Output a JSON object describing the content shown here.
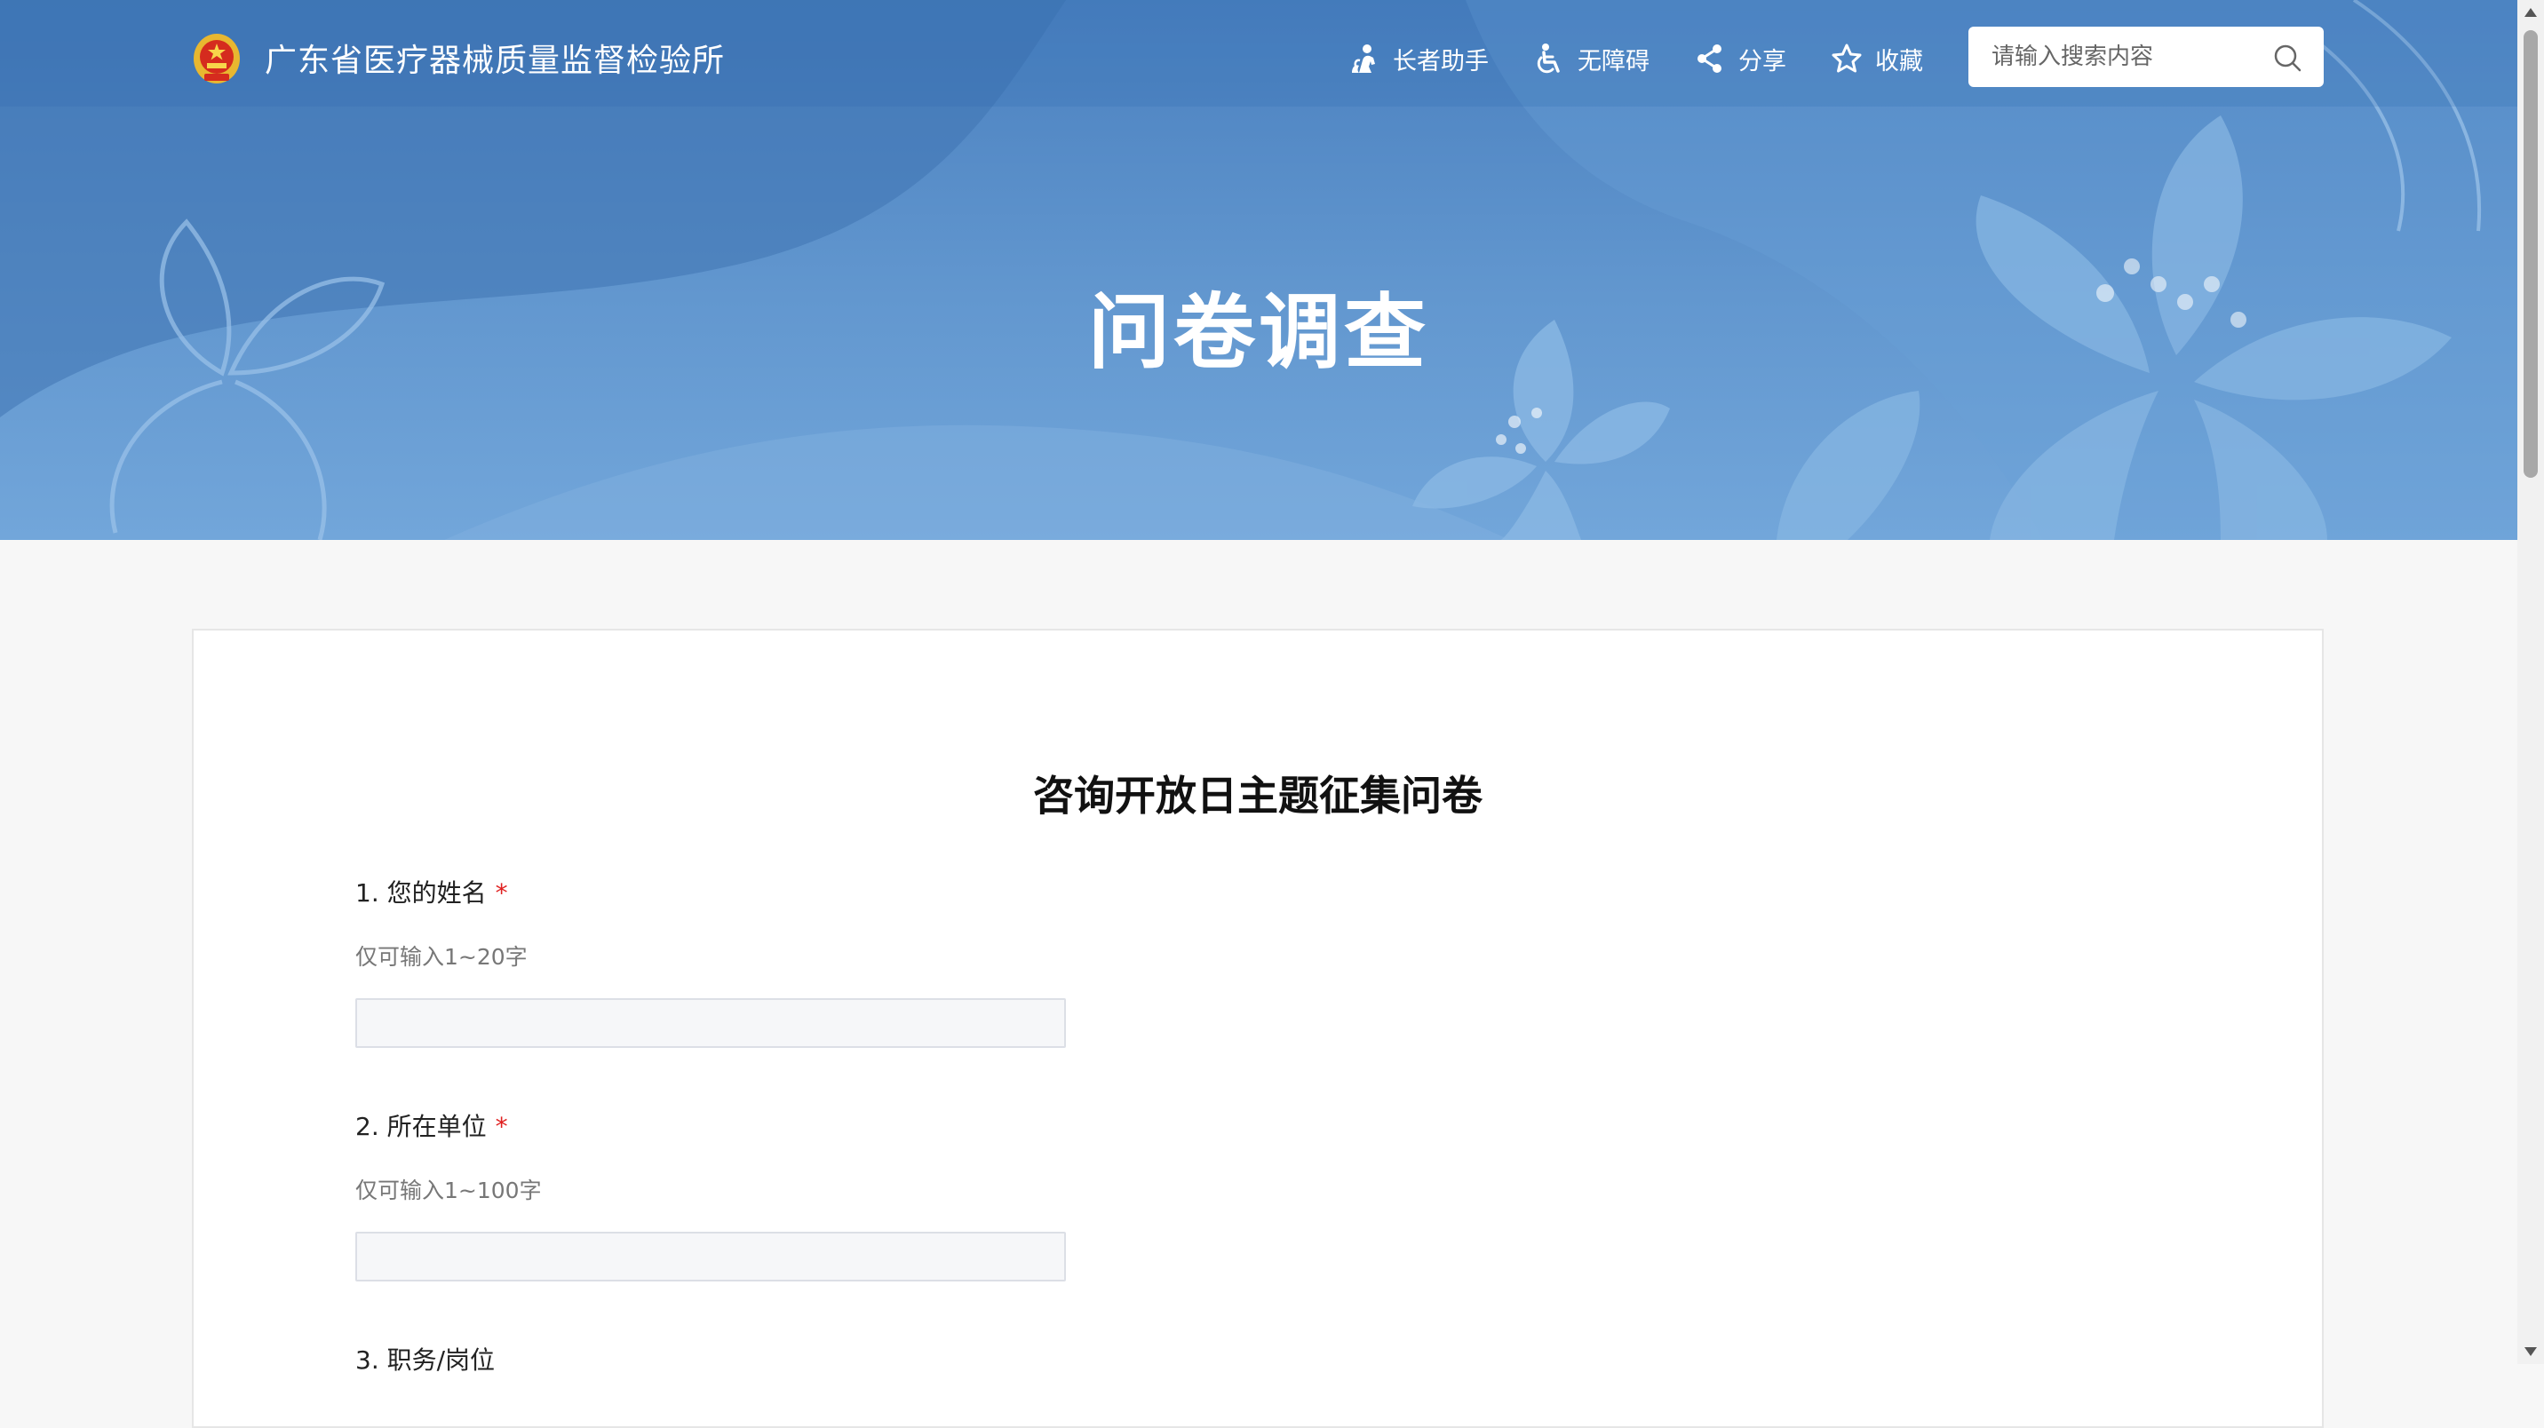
{
  "header": {
    "site_name": "广东省医疗器械质量监督检验所",
    "nav": [
      {
        "label": "长者助手",
        "icon": "elder-assist-icon"
      },
      {
        "label": "无障碍",
        "icon": "wheelchair-icon"
      },
      {
        "label": "分享",
        "icon": "share-icon"
      },
      {
        "label": "收藏",
        "icon": "star-icon"
      }
    ],
    "search": {
      "placeholder": "请输入搜索内容",
      "icon": "search-icon"
    }
  },
  "banner": {
    "title": "问卷调查"
  },
  "survey": {
    "title": "咨询开放日主题征集问卷",
    "questions": [
      {
        "label": "1. 您的姓名",
        "required_mark": "*",
        "hint": "仅可输入1~20字",
        "value": ""
      },
      {
        "label": "2. 所在单位",
        "required_mark": "*",
        "hint": "仅可输入1~100字",
        "value": ""
      },
      {
        "label": "3. 职务/岗位"
      }
    ]
  },
  "colors": {
    "banner": "#5a8fcb",
    "required": "#e02020",
    "page_bg": "#f7f7f7"
  }
}
